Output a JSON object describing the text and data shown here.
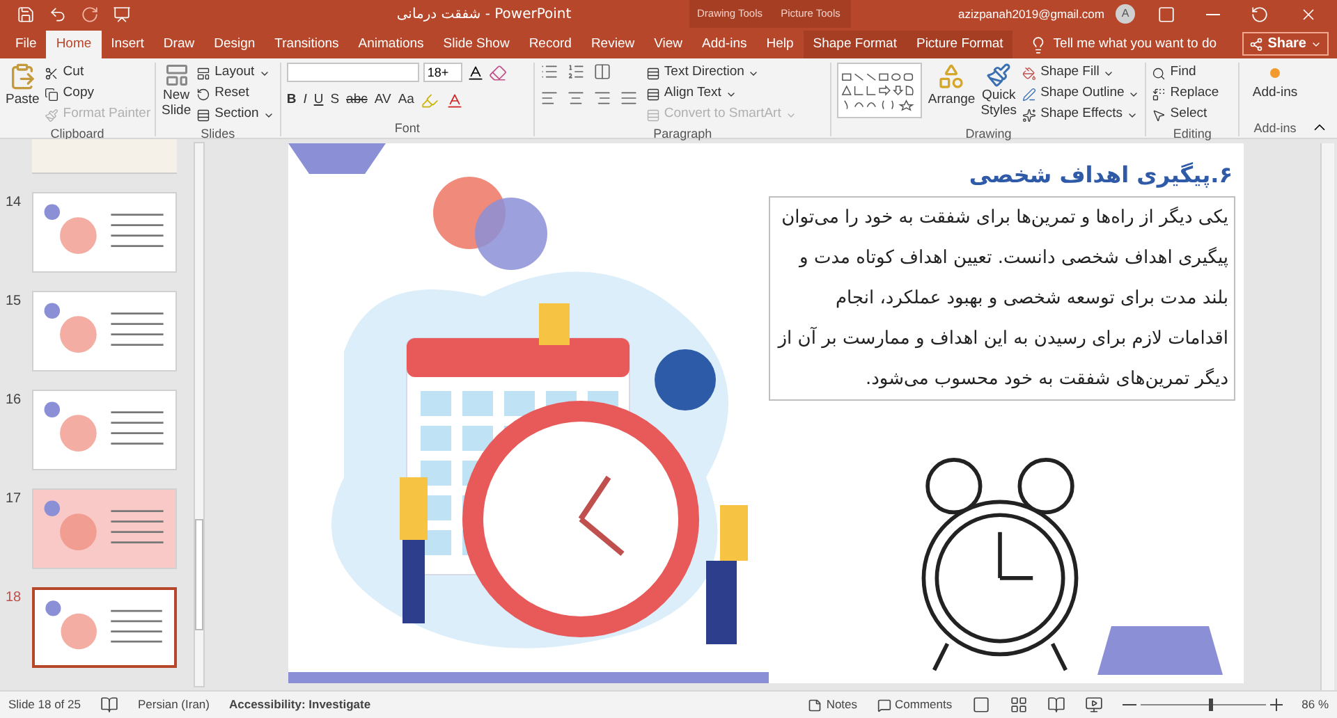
{
  "title_bar": {
    "title": "شفقت درمانی  -  PowerPoint",
    "context_groups": [
      "Drawing Tools",
      "Picture Tools"
    ],
    "account": "azizpanah2019@gmail.com",
    "avatar_initial": "A"
  },
  "tabs": [
    {
      "label": "File",
      "selected": false,
      "contextual": false
    },
    {
      "label": "Home",
      "selected": true,
      "contextual": false
    },
    {
      "label": "Insert",
      "selected": false,
      "contextual": false
    },
    {
      "label": "Draw",
      "selected": false,
      "contextual": false
    },
    {
      "label": "Design",
      "selected": false,
      "contextual": false
    },
    {
      "label": "Transitions",
      "selected": false,
      "contextual": false
    },
    {
      "label": "Animations",
      "selected": false,
      "contextual": false
    },
    {
      "label": "Slide Show",
      "selected": false,
      "contextual": false
    },
    {
      "label": "Record",
      "selected": false,
      "contextual": false
    },
    {
      "label": "Review",
      "selected": false,
      "contextual": false
    },
    {
      "label": "View",
      "selected": false,
      "contextual": false
    },
    {
      "label": "Add-ins",
      "selected": false,
      "contextual": false
    },
    {
      "label": "Help",
      "selected": false,
      "contextual": false
    },
    {
      "label": "Shape Format",
      "selected": false,
      "contextual": true
    },
    {
      "label": "Picture Format",
      "selected": false,
      "contextual": true
    }
  ],
  "tell_me": "Tell me what you want to do",
  "share": "Share",
  "ribbon": {
    "clipboard": {
      "label": "Clipboard",
      "paste": "Paste",
      "buttons": [
        {
          "label": "Cut",
          "disabled": false
        },
        {
          "label": "Copy",
          "disabled": false
        },
        {
          "label": "Format Painter",
          "disabled": true
        }
      ]
    },
    "slides": {
      "label": "Slides",
      "new_slide": [
        "New",
        "Slide"
      ],
      "buttons": [
        {
          "label": "Layout"
        },
        {
          "label": "Reset"
        },
        {
          "label": "Section"
        }
      ]
    },
    "font": {
      "label": "Font",
      "size": "18+",
      "format_buttons": [
        "B",
        "I",
        "U",
        "S",
        "abc",
        "AV",
        "Aa"
      ]
    },
    "paragraph": {
      "label": "Paragraph",
      "buttons": [
        {
          "label": "Text Direction",
          "disabled": false
        },
        {
          "label": "Align Text",
          "disabled": false
        },
        {
          "label": "Convert to SmartArt",
          "disabled": true
        }
      ]
    },
    "drawing": {
      "label": "Drawing",
      "arrange": "Arrange",
      "quick_styles": [
        "Quick",
        "Styles"
      ],
      "buttons": [
        "Shape Fill",
        "Shape Outline",
        "Shape Effects"
      ]
    },
    "editing": {
      "label": "Editing",
      "buttons": [
        "Find",
        "Replace",
        "Select"
      ]
    },
    "addins": {
      "label": "Add-ins",
      "button": "Add-ins"
    }
  },
  "thumbnails": [
    {
      "number": "14",
      "selected": false,
      "color": "#ffffff"
    },
    {
      "number": "15",
      "selected": false,
      "color": "#ffffff"
    },
    {
      "number": "16",
      "selected": false,
      "color": "#ffffff"
    },
    {
      "number": "17",
      "selected": false,
      "color": "#f8c9c6"
    },
    {
      "number": "18",
      "selected": true,
      "color": "#ffffff"
    }
  ],
  "slide": {
    "title": "۶.پیگیری اهداف شخصی",
    "body": "یکی دیگر از راه‌ها و تمرین‌ها برای شفقت به خود را می‌توان پیگیری اهداف شخصی دانست. تعیین اهداف کوتاه مدت و بلند مدت برای توسعه شخصی و بهبود عملکرد، انجام اقدامات لازم برای رسیدن به این اهداف و ممارست بر آن از دیگر تمرین‌های شفقت به خود محسوب می‌شود."
  },
  "status_bar": {
    "slide": "Slide 18 of 25",
    "language": "Persian (Iran)",
    "accessibility": "Accessibility: Investigate",
    "notes": "Notes",
    "comments": "Comments",
    "zoom": {
      "level": 0.55
    },
    "zoom_reading": "86 %"
  }
}
